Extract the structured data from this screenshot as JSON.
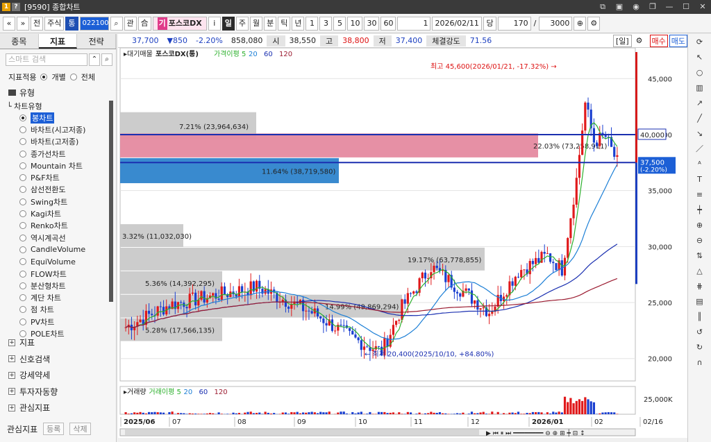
{
  "window": {
    "title": "[9590] 종합차트",
    "icon_help": "?"
  },
  "toolbar": {
    "nav_prev": "«",
    "nav_next": "»",
    "market": "전",
    "type": "주식",
    "badge": "통",
    "code": "022100",
    "search": "관",
    "order": "合",
    "stock_prefix": "기",
    "stock_name": "포스코DX",
    "info": "i",
    "periods": [
      "일",
      "주",
      "월",
      "분",
      "틱",
      "년"
    ],
    "active_period": "일",
    "minutes": [
      "1",
      "3",
      "5",
      "10",
      "30",
      "60"
    ],
    "interval_value": "1",
    "date": "2026/02/11",
    "count_label": "당",
    "count": "170",
    "slash": "/",
    "max_count": "3000"
  },
  "left_panel": {
    "tabs": [
      "종목",
      "지표",
      "전략"
    ],
    "active_tab": "지표",
    "search_placeholder": "스마트 검색",
    "apply_label": "지표적용",
    "apply_options": [
      "개별",
      "전체"
    ],
    "group_label": "유형",
    "sub_label": "차트유형",
    "chart_types": [
      "봉차트",
      "바차트(시고저종)",
      "바차트(고저종)",
      "종가선차트",
      "Mountain 차트",
      "P&F차트",
      "삼선전환도",
      "Swing차트",
      "Kagi차트",
      "Renko차트",
      "역시계곡선",
      "CandleVolume",
      "EquiVolume",
      "FLOW차트",
      "분산형차트",
      "계단 차트",
      "점 차트",
      "PV차트",
      "POLE차트"
    ],
    "selected_type": "봉차트",
    "categories": [
      "지표",
      "신호검색",
      "강세약세",
      "투자자동향",
      "관심지표"
    ],
    "footer_label": "관심지표",
    "footer_buttons": [
      "등록",
      "삭제"
    ]
  },
  "quote": {
    "price": "37,700",
    "change": "▼850",
    "pct": "-2.20%",
    "volume": "858,080",
    "open_label": "시",
    "open": "38,550",
    "high_label": "고",
    "high": "38,800",
    "low_label": "저",
    "low": "37,400",
    "strength_label": "체결강도",
    "strength": "71.56",
    "period_tag": "[일]",
    "buy": "매수",
    "sell": "매도"
  },
  "chart_data": {
    "type": "candlestick",
    "price_legend": [
      "대기매물",
      "포스코DX(통)",
      "가격이평 5",
      "20",
      "60",
      "120"
    ],
    "volume_legend": [
      "거래량",
      "거래이평 5",
      "20",
      "60",
      "120"
    ],
    "ma_colors": {
      "ma5": "#2db02d",
      "ma20": "#1c7fd6",
      "ma60": "#1a2fb0",
      "ma120": "#9b1b30"
    },
    "y_ticks": [
      45000,
      40000,
      35000,
      30000,
      25000,
      20000
    ],
    "y_tick_labels": [
      "45,000",
      "40,000",
      "35,000",
      "30,000",
      "25,000",
      "20,000"
    ],
    "ylim": [
      18000,
      47000
    ],
    "x_labels": [
      "2025/06",
      "07",
      "08",
      "09",
      "10",
      "11",
      "12",
      "2026/01",
      "02",
      "02/16"
    ],
    "volume_tick_label": "25,000K",
    "high_annotation": "최고 45,600(2026/01/21, -17.32%)",
    "low_annotation": "최저 20,400(2025/10/10, +84.80%)",
    "current_price_label": "37,500",
    "current_change_label": "(-2.20%)",
    "level_label": "40,000",
    "overhead_supply": [
      {
        "label": "7.21% (23,964,634)",
        "price_low": 39500,
        "price_high": 42000,
        "share": 0.28
      },
      {
        "label": "22.03% (73,258,911)",
        "price_low": 37900,
        "price_high": 40100,
        "share": 0.86
      },
      {
        "label": "11.64% (38,719,580)",
        "price_low": 35600,
        "price_high": 37900,
        "share": 0.45
      },
      {
        "label": "3.32% (11,032,030)",
        "price_low": 29900,
        "price_high": 32000,
        "share": 0.13
      },
      {
        "label": "19.17% (63,778,855)",
        "price_low": 27800,
        "price_high": 29900,
        "share": 0.75
      },
      {
        "label": "5.36% (14,392,295)",
        "price_low": 25700,
        "price_high": 27800,
        "share": 0.21
      },
      {
        "label": "14.99% (49,869,294)",
        "price_low": 23600,
        "price_high": 25700,
        "share": 0.58
      },
      {
        "label": "5.28% (17,566,135)",
        "price_low": 21500,
        "price_high": 23600,
        "share": 0.21
      }
    ]
  },
  "right_tools": [
    "refresh-icon",
    "cursor-icon",
    "circle-icon",
    "bar-icon",
    "trend-icon",
    "line-icon",
    "ray-icon",
    "diagonal-icon",
    "auto-icon",
    "text-icon",
    "fib-icon",
    "candle-icon",
    "zoom-icon",
    "zoom-out-icon",
    "arrows-icon",
    "triangle-icon",
    "channel-icon",
    "gann-icon",
    "cycle-icon",
    "undo-icon",
    "redo-icon",
    "magnet-icon"
  ]
}
